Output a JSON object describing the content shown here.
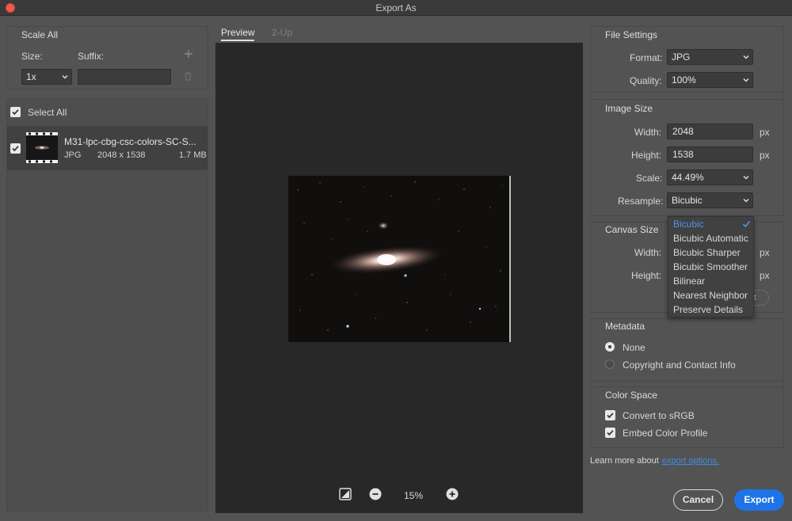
{
  "window": {
    "title": "Export As"
  },
  "scale_all": {
    "title": "Scale All",
    "size_label": "Size:",
    "suffix_label": "Suffix:",
    "size_value": "1x",
    "suffix_value": "",
    "add_icon": "plus-icon",
    "delete_icon": "trash-icon"
  },
  "asset_list": {
    "select_all_label": "Select All",
    "select_all_checked": true,
    "items": [
      {
        "name": "M31-lpc-cbg-csc-colors-SC-S...",
        "format": "JPG",
        "dimensions": "2048 x 1538",
        "size": "1.7 MB",
        "checked": true
      }
    ]
  },
  "preview": {
    "tabs": [
      {
        "label": "Preview",
        "active": true
      },
      {
        "label": "2-Up",
        "active": false
      }
    ],
    "zoom": "15%"
  },
  "file_settings": {
    "title": "File Settings",
    "format_label": "Format:",
    "format_value": "JPG",
    "quality_label": "Quality:",
    "quality_value": "100%"
  },
  "image_size": {
    "title": "Image Size",
    "width_label": "Width:",
    "width_value": "2048",
    "height_label": "Height:",
    "height_value": "1538",
    "unit": "px",
    "scale_label": "Scale:",
    "scale_value": "44.49%",
    "resample_label": "Resample:",
    "resample_value": "Bicubic"
  },
  "resample_menu": {
    "options": [
      "Bicubic",
      "Bicubic Automatic",
      "Bicubic Sharper",
      "Bicubic Smoother",
      "Bilinear",
      "Nearest Neighbor",
      "Preserve Details"
    ],
    "selected": "Bicubic"
  },
  "canvas_size": {
    "title": "Canvas Size",
    "width_label": "Width:",
    "height_label": "Height:",
    "unit": "px",
    "reset_fragment": "t"
  },
  "metadata": {
    "title": "Metadata",
    "options": [
      {
        "label": "None",
        "selected": true
      },
      {
        "label": "Copyright and Contact Info",
        "selected": false
      }
    ]
  },
  "color_space": {
    "title": "Color Space",
    "convert_label": "Convert to sRGB",
    "convert_checked": true,
    "embed_label": "Embed Color Profile",
    "embed_checked": true
  },
  "footer": {
    "learn_more_text": "Learn more about",
    "learn_more_link": "export options.",
    "cancel_label": "Cancel",
    "export_label": "Export"
  },
  "colors": {
    "accent": "#1e74e6",
    "menu_selected": "#4e95e8",
    "close_button": "#ee5a52"
  }
}
